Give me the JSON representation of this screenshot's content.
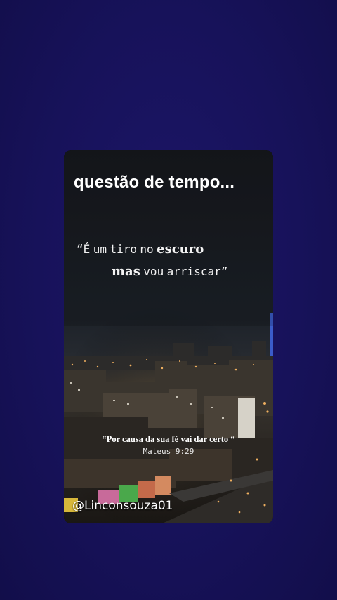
{
  "story": {
    "title": "questão de tempo...",
    "quote": {
      "open_mark": "“É",
      "word1": "um",
      "word2": "tiro",
      "word3": "no",
      "bold1": "escuro",
      "bold2": "mas",
      "word4": "vou",
      "word5": "arriscar”"
    },
    "verse_caption": "“Por causa da sua fé vai dar certo “",
    "verse_reference": "Mateus 9:29",
    "handle": "@Linconsouza01"
  },
  "colors": {
    "page_background": "#17125a",
    "sky": "#1a1f26",
    "city_lights": "#f0b060",
    "text": "#ffffff"
  },
  "icons": []
}
